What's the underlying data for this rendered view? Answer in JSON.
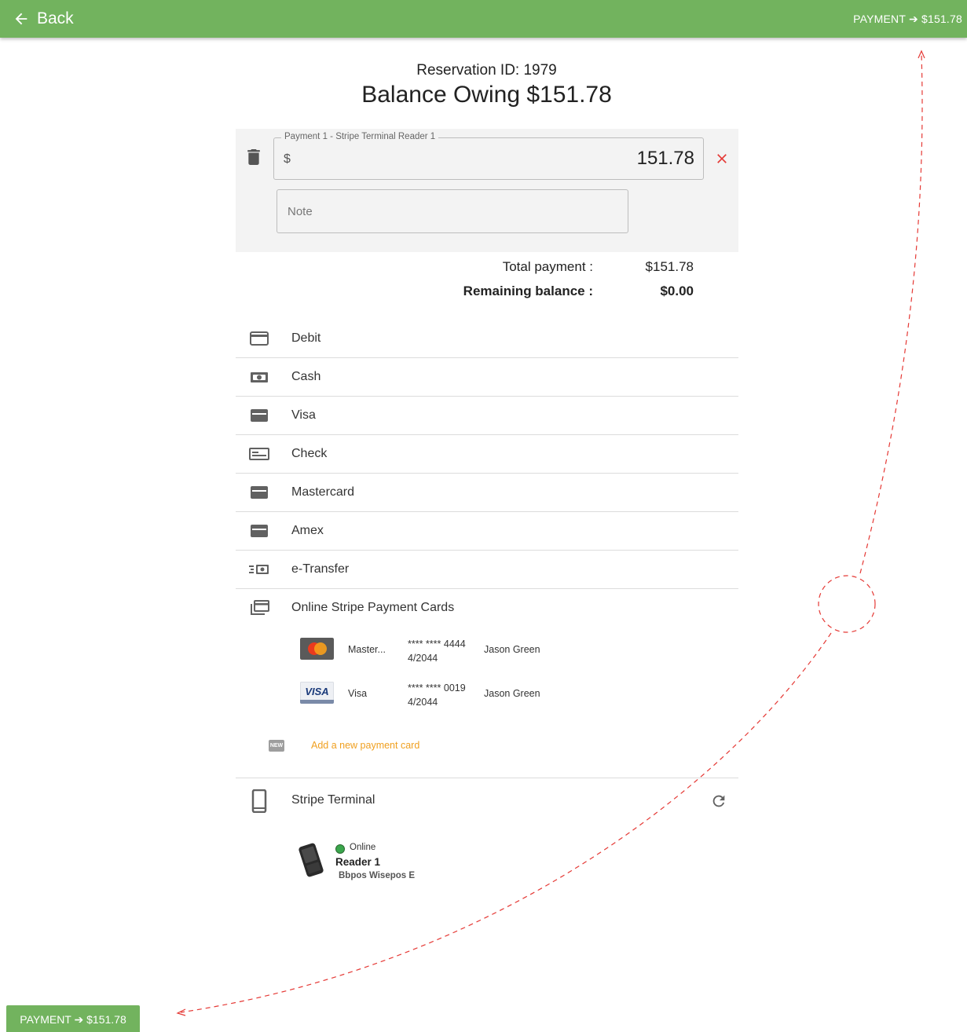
{
  "header": {
    "back_label": "Back",
    "payment_label": "PAYMENT ➔ $151.78",
    "bar_color": "#72b35e"
  },
  "reservation": {
    "id_text": "Reservation ID: 1979",
    "balance_text": "Balance Owing $151.78"
  },
  "payment_entry": {
    "legend": "Payment 1 - Stripe Terminal Reader 1",
    "currency_symbol": "$",
    "amount": "151.78",
    "note_placeholder": "Note",
    "remove_color": "#e53935"
  },
  "totals": {
    "total_label": "Total payment :",
    "total_value": "$151.78",
    "remaining_label": "Remaining balance :",
    "remaining_value": "$0.00"
  },
  "methods": [
    {
      "label": "Debit",
      "icon": "credit-card-outline-icon"
    },
    {
      "label": "Cash",
      "icon": "cash-icon"
    },
    {
      "label": "Visa",
      "icon": "credit-card-icon"
    },
    {
      "label": "Check",
      "icon": "check-icon"
    },
    {
      "label": "Mastercard",
      "icon": "credit-card-icon"
    },
    {
      "label": "Amex",
      "icon": "credit-card-icon"
    },
    {
      "label": "e-Transfer",
      "icon": "e-transfer-icon"
    }
  ],
  "stripe_cards": {
    "title": "Online Stripe Payment Cards",
    "cards": [
      {
        "brand": "Master...",
        "number": "**** **** 4444",
        "expiry": "4/2044",
        "owner": "Jason Green",
        "icon": "mastercard-logo-icon"
      },
      {
        "brand": "Visa",
        "number": "**** **** 0019",
        "expiry": "4/2044",
        "owner": "Jason Green",
        "icon": "visa-logo-icon"
      }
    ],
    "new_badge": "NEW",
    "add_label": "Add a new payment card",
    "add_color": "#f0a020"
  },
  "terminal": {
    "title": "Stripe Terminal",
    "reader_status": "Online",
    "reader_name": "Reader 1",
    "reader_model": "Bbpos Wisepos E",
    "status_color": "#3aa64c"
  },
  "bottom_button": {
    "label": "PAYMENT ➔ $151.78"
  }
}
